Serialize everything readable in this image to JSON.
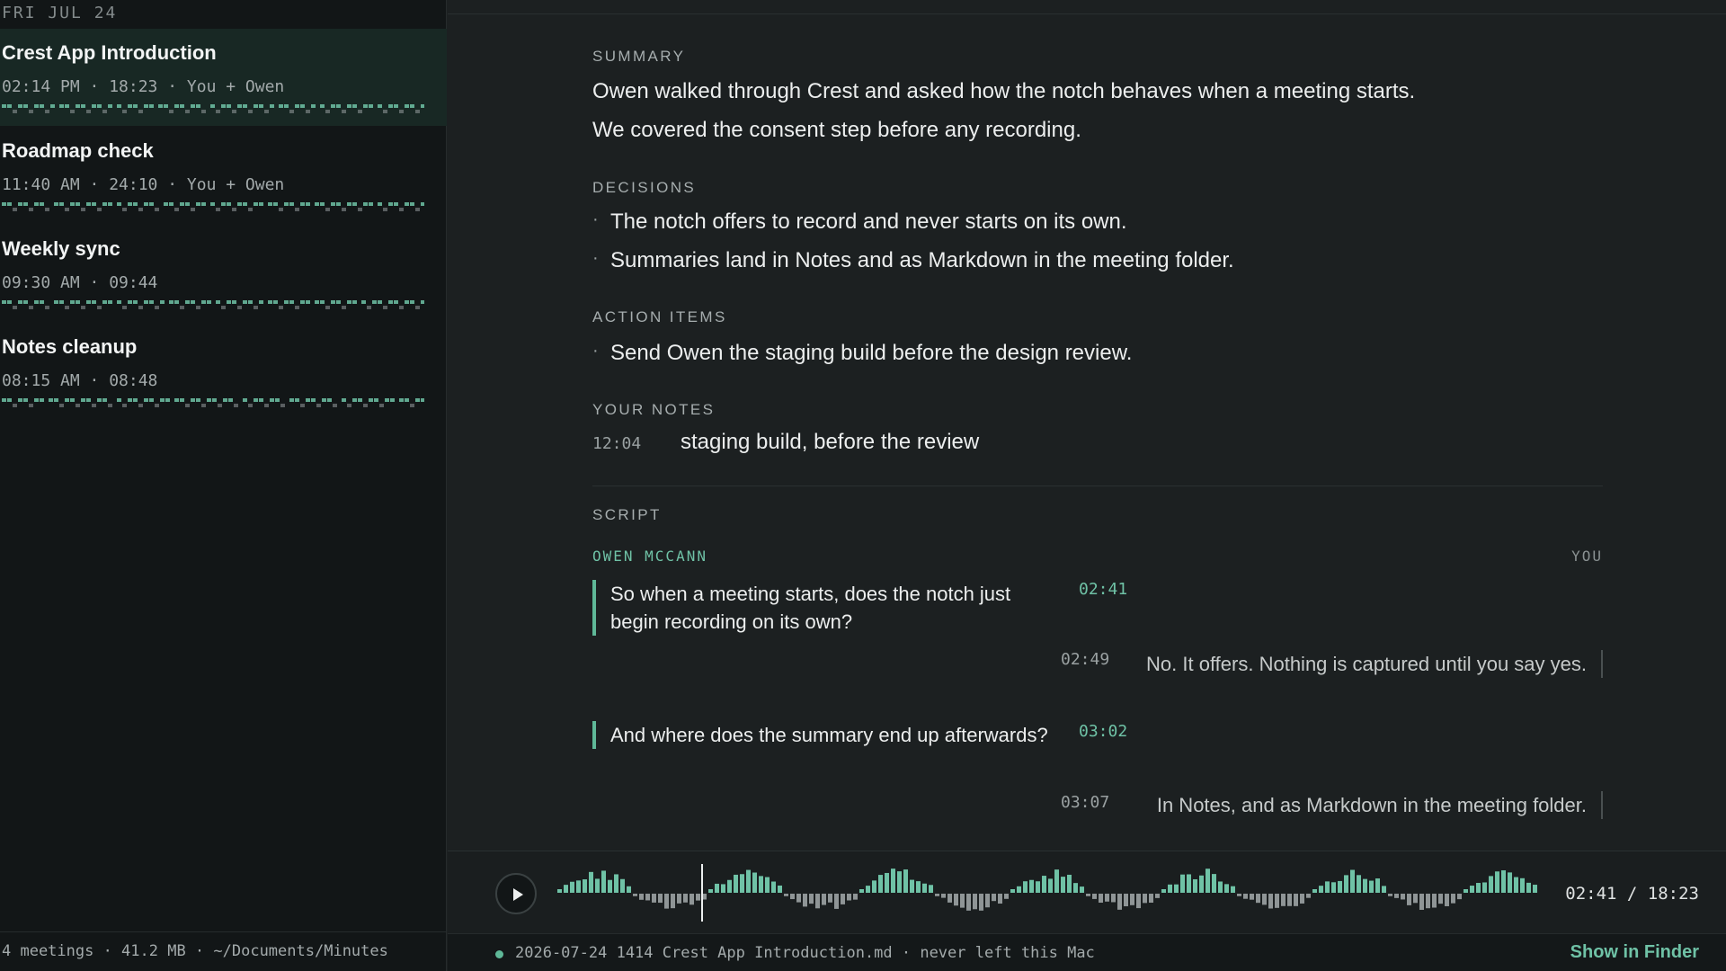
{
  "sidebar": {
    "date_header": "FRI JUL 24",
    "meetings": [
      {
        "title": "Crest App Introduction",
        "meta": "02:14 PM · 18:23 · You + Owen",
        "active": true
      },
      {
        "title": "Roadmap check",
        "meta": "11:40 AM · 24:10 · You + Owen",
        "active": false
      },
      {
        "title": "Weekly sync",
        "meta": "09:30 AM · 09:44",
        "active": false
      },
      {
        "title": "Notes cleanup",
        "meta": "08:15 AM · 08:48",
        "active": false
      }
    ],
    "footer": "4 meetings · 41.2 MB · ~/Documents/Minutes"
  },
  "summary": {
    "label": "SUMMARY",
    "lines": [
      "Owen walked through Crest and asked how the notch behaves when a meeting starts.",
      "We covered the consent step before any recording."
    ]
  },
  "decisions": {
    "label": "DECISIONS",
    "items": [
      "The notch offers to record and never starts on its own.",
      "Summaries land in Notes and as Markdown in the meeting folder."
    ]
  },
  "action_items": {
    "label": "ACTION ITEMS",
    "items": [
      "Send Owen the staging build before the design review."
    ]
  },
  "your_notes": {
    "label": "YOUR NOTES",
    "items": [
      {
        "time": "12:04",
        "text": "staging build, before the review"
      }
    ]
  },
  "script": {
    "label": "SCRIPT",
    "speaker_left": "OWEN MCCANN",
    "speaker_right": "YOU",
    "utterances": [
      {
        "speaker": "left",
        "time": "02:41",
        "text": "So when a meeting starts, does the notch just begin recording on its own?"
      },
      {
        "speaker": "right",
        "time": "02:49",
        "text": "No. It offers. Nothing is captured until you say yes."
      },
      {
        "speaker": "left",
        "time": "03:02",
        "text": "And where does the summary end up afterwards?"
      },
      {
        "speaker": "right",
        "time": "03:07",
        "text": "In Notes, and as Markdown in the meeting folder."
      }
    ]
  },
  "player": {
    "time_readout": "02:41 / 18:23",
    "current_seconds": 161,
    "total_seconds": 1103
  },
  "status_bar": {
    "text": "2026-07-24 1414 Crest App Introduction.md · never left this Mac",
    "show_in_finder": "Show in Finder"
  },
  "colors": {
    "accent": "#6fc2a6",
    "background": "#1c2021",
    "sidebar": "#121617",
    "active_row": "#182824"
  },
  "icons": {
    "play": "play-icon",
    "status": "status-dot-icon"
  }
}
